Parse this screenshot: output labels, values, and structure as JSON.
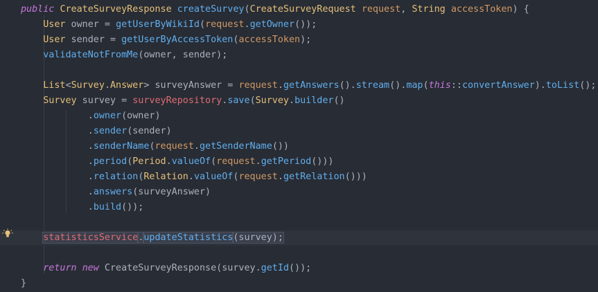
{
  "editor": {
    "language": "java",
    "lines": [
      [
        {
          "t": "public",
          "c": "kw"
        },
        {
          "t": " ",
          "c": "pl"
        },
        {
          "t": "CreateSurveyResponse",
          "c": "ty"
        },
        {
          "t": " ",
          "c": "pl"
        },
        {
          "t": "createSurvey",
          "c": "fn"
        },
        {
          "t": "(",
          "c": "pl"
        },
        {
          "t": "CreateSurveyRequest",
          "c": "ty"
        },
        {
          "t": " ",
          "c": "pl"
        },
        {
          "t": "request",
          "c": "par"
        },
        {
          "t": ", ",
          "c": "pl"
        },
        {
          "t": "String",
          "c": "ty"
        },
        {
          "t": " ",
          "c": "pl"
        },
        {
          "t": "accessToken",
          "c": "par"
        },
        {
          "t": ") {",
          "c": "pl"
        }
      ],
      [
        {
          "t": "    ",
          "c": "pl"
        },
        {
          "t": "User",
          "c": "ty"
        },
        {
          "t": " owner = ",
          "c": "pl"
        },
        {
          "t": "getUserByWikiId",
          "c": "fn"
        },
        {
          "t": "(",
          "c": "pl"
        },
        {
          "t": "request",
          "c": "par"
        },
        {
          "t": ".",
          "c": "pl"
        },
        {
          "t": "getOwner",
          "c": "fn"
        },
        {
          "t": "());",
          "c": "pl"
        }
      ],
      [
        {
          "t": "    ",
          "c": "pl"
        },
        {
          "t": "User",
          "c": "ty"
        },
        {
          "t": " sender = ",
          "c": "pl"
        },
        {
          "t": "getUserByAccessToken",
          "c": "fn"
        },
        {
          "t": "(",
          "c": "pl"
        },
        {
          "t": "accessToken",
          "c": "par"
        },
        {
          "t": ");",
          "c": "pl"
        }
      ],
      [
        {
          "t": "    ",
          "c": "pl"
        },
        {
          "t": "validateNotFromMe",
          "c": "fn"
        },
        {
          "t": "(owner, sender);",
          "c": "pl"
        }
      ],
      [],
      [
        {
          "t": "    ",
          "c": "pl"
        },
        {
          "t": "List",
          "c": "ty"
        },
        {
          "t": "<",
          "c": "pl"
        },
        {
          "t": "Survey",
          "c": "ty"
        },
        {
          "t": ".",
          "c": "pl"
        },
        {
          "t": "Answer",
          "c": "ty"
        },
        {
          "t": "> surveyAnswer = ",
          "c": "pl"
        },
        {
          "t": "request",
          "c": "par"
        },
        {
          "t": ".",
          "c": "pl"
        },
        {
          "t": "getAnswers",
          "c": "fn"
        },
        {
          "t": "().",
          "c": "pl"
        },
        {
          "t": "stream",
          "c": "fn"
        },
        {
          "t": "().",
          "c": "pl"
        },
        {
          "t": "map",
          "c": "fn"
        },
        {
          "t": "(",
          "c": "pl"
        },
        {
          "t": "this",
          "c": "kw"
        },
        {
          "t": "::",
          "c": "pl"
        },
        {
          "t": "convertAnswer",
          "c": "fn"
        },
        {
          "t": ").",
          "c": "pl"
        },
        {
          "t": "toList",
          "c": "fn"
        },
        {
          "t": "();",
          "c": "pl"
        }
      ],
      [
        {
          "t": "    ",
          "c": "pl"
        },
        {
          "t": "Survey",
          "c": "ty"
        },
        {
          "t": " survey = ",
          "c": "pl"
        },
        {
          "t": "surveyRepository",
          "c": "fld"
        },
        {
          "t": ".",
          "c": "pl"
        },
        {
          "t": "save",
          "c": "fn"
        },
        {
          "t": "(",
          "c": "pl"
        },
        {
          "t": "Survey",
          "c": "ty"
        },
        {
          "t": ".",
          "c": "pl"
        },
        {
          "t": "builder",
          "c": "fn"
        },
        {
          "t": "()",
          "c": "pl"
        }
      ],
      [
        {
          "t": "            .",
          "c": "pl"
        },
        {
          "t": "owner",
          "c": "fn"
        },
        {
          "t": "(owner)",
          "c": "pl"
        }
      ],
      [
        {
          "t": "            .",
          "c": "pl"
        },
        {
          "t": "sender",
          "c": "fn"
        },
        {
          "t": "(sender)",
          "c": "pl"
        }
      ],
      [
        {
          "t": "            .",
          "c": "pl"
        },
        {
          "t": "senderName",
          "c": "fn"
        },
        {
          "t": "(",
          "c": "pl"
        },
        {
          "t": "request",
          "c": "par"
        },
        {
          "t": ".",
          "c": "pl"
        },
        {
          "t": "getSenderName",
          "c": "fn"
        },
        {
          "t": "())",
          "c": "pl"
        }
      ],
      [
        {
          "t": "            .",
          "c": "pl"
        },
        {
          "t": "period",
          "c": "fn"
        },
        {
          "t": "(",
          "c": "pl"
        },
        {
          "t": "Period",
          "c": "ty"
        },
        {
          "t": ".",
          "c": "pl"
        },
        {
          "t": "valueOf",
          "c": "fn"
        },
        {
          "t": "(",
          "c": "pl"
        },
        {
          "t": "request",
          "c": "par"
        },
        {
          "t": ".",
          "c": "pl"
        },
        {
          "t": "getPeriod",
          "c": "fn"
        },
        {
          "t": "()))",
          "c": "pl"
        }
      ],
      [
        {
          "t": "            .",
          "c": "pl"
        },
        {
          "t": "relation",
          "c": "fn"
        },
        {
          "t": "(",
          "c": "pl"
        },
        {
          "t": "Relation",
          "c": "ty"
        },
        {
          "t": ".",
          "c": "pl"
        },
        {
          "t": "valueOf",
          "c": "fn"
        },
        {
          "t": "(",
          "c": "pl"
        },
        {
          "t": "request",
          "c": "par"
        },
        {
          "t": ".",
          "c": "pl"
        },
        {
          "t": "getRelation",
          "c": "fn"
        },
        {
          "t": "()))",
          "c": "pl"
        }
      ],
      [
        {
          "t": "            .",
          "c": "pl"
        },
        {
          "t": "answers",
          "c": "fn"
        },
        {
          "t": "(surveyAnswer)",
          "c": "pl"
        }
      ],
      [
        {
          "t": "            .",
          "c": "pl"
        },
        {
          "t": "build",
          "c": "fn"
        },
        {
          "t": "());",
          "c": "pl"
        }
      ],
      [],
      [
        {
          "t": "    ",
          "c": "pl"
        },
        {
          "t": "statisticsService",
          "c": "fld"
        },
        {
          "t": ".",
          "c": "pl"
        },
        {
          "t": "updateStatistics",
          "c": "fn"
        },
        {
          "t": "(survey);",
          "c": "pl"
        }
      ],
      [],
      [
        {
          "t": "    ",
          "c": "pl"
        },
        {
          "t": "return",
          "c": "kw"
        },
        {
          "t": " ",
          "c": "pl"
        },
        {
          "t": "new",
          "c": "kw"
        },
        {
          "t": " CreateSurveyResponse(survey.",
          "c": "pl"
        },
        {
          "t": "getId",
          "c": "fn"
        },
        {
          "t": "());",
          "c": "pl"
        }
      ],
      [
        {
          "t": "}",
          "c": "pl"
        }
      ]
    ],
    "current_line": 15,
    "gutter_icon": "lightbulb-icon",
    "colors": {
      "background": "#282c34",
      "current_line": "#2e333c",
      "keyword": "#c678dd",
      "type": "#e5c07b",
      "function": "#61afef",
      "field": "#e06c75",
      "parameter": "#d19a66",
      "plain": "#abb2bf",
      "bulb": "#e5c07b"
    }
  }
}
